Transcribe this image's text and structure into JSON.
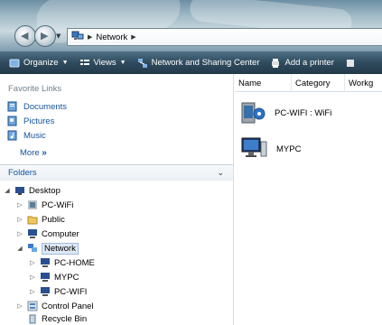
{
  "address": {
    "breadcrumb_root_icon": "network-icon",
    "current": "Network"
  },
  "toolbar": {
    "items": [
      {
        "label": "Organize",
        "icon": "organize-icon",
        "has_dropdown": true
      },
      {
        "label": "Views",
        "icon": "views-icon",
        "has_dropdown": true
      },
      {
        "label": "Network and Sharing Center",
        "icon": "network-sharing-icon",
        "has_dropdown": false
      },
      {
        "label": "Add a printer",
        "icon": "printer-icon",
        "has_dropdown": false
      }
    ]
  },
  "favorites": {
    "header": "Favorite Links",
    "items": [
      {
        "label": "Documents",
        "icon": "documents-icon"
      },
      {
        "label": "Pictures",
        "icon": "pictures-icon"
      },
      {
        "label": "Music",
        "icon": "music-icon"
      }
    ],
    "more": "More",
    "more_suffix": "»"
  },
  "folders": {
    "label": "Folders",
    "tree": [
      {
        "label": "Desktop",
        "icon": "desktop-icon"
      },
      {
        "label": "PC-WiFi",
        "icon": "user-folder-icon"
      },
      {
        "label": "Public",
        "icon": "folder-icon"
      },
      {
        "label": "Computer",
        "icon": "computer-icon"
      },
      {
        "label": "Network",
        "icon": "network-icon"
      },
      {
        "label": "PC-HOME",
        "icon": "computer-icon"
      },
      {
        "label": "MYPC",
        "icon": "computer-icon"
      },
      {
        "label": "PC-WIFI",
        "icon": "computer-icon"
      },
      {
        "label": "Control Panel",
        "icon": "control-panel-icon"
      },
      {
        "label": "Recycle Bin",
        "icon": "recycle-bin-icon"
      }
    ]
  },
  "content": {
    "columns": [
      "Name",
      "Category",
      "Workg"
    ],
    "items": [
      {
        "label": "PC-WIFI : WiFi",
        "icon": "media-device-icon"
      },
      {
        "label": "MYPC",
        "icon": "computer-icon"
      }
    ]
  }
}
